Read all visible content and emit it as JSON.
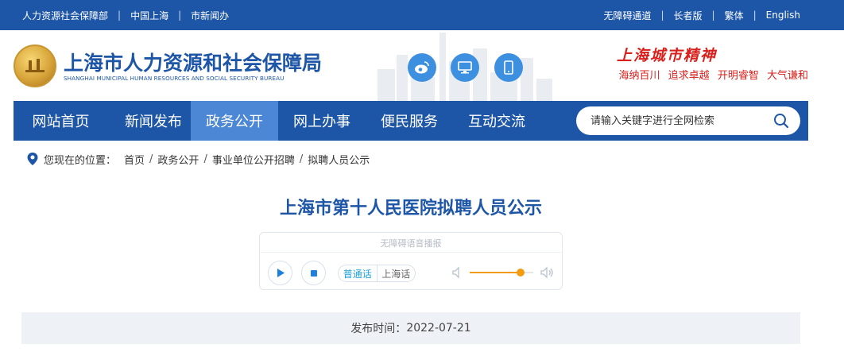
{
  "topbar": {
    "left_links": [
      "人力资源社会保障部",
      "中国上海",
      "市新闻办"
    ],
    "right_links": [
      "无障碍通道",
      "长者版",
      "繁体",
      "English"
    ]
  },
  "header": {
    "title": "上海市人力资源和社会保障局",
    "subtitle": "SHANGHAI MUNICIPAL HUMAN RESOURCES AND SOCIAL SECURITY BUREAU",
    "social_icons": [
      "weibo-icon",
      "monitor-icon",
      "mobile-icon"
    ],
    "spirit_title": "上海城市精神",
    "slogans": [
      "海纳百川",
      "追求卓越",
      "开明睿智",
      "大气谦和"
    ]
  },
  "nav": {
    "items": [
      "网站首页",
      "新闻发布",
      "政务公开",
      "网上办事",
      "便民服务",
      "互动交流"
    ],
    "active": "政务公开",
    "search_placeholder": "请输入关键字进行全网检索"
  },
  "breadcrumb": {
    "lead": "您现在的位置：",
    "items": [
      "首页",
      "政务公开",
      "事业单位公开招聘",
      "拟聘人员公示"
    ]
  },
  "article": {
    "title": "上海市第十人民医院拟聘人员公示",
    "publish_label": "发布时间：",
    "publish_date": "2022-07-21"
  },
  "player": {
    "title": "无障碍语音播报",
    "lang_options": [
      "普通话",
      "上海话"
    ],
    "selected_lang": "普通话",
    "volume": 0.8
  },
  "colors": {
    "brand_blue": "#1e56a7",
    "nav_active": "#4b87d4",
    "spirit_red": "#d8201c",
    "accent_orange": "#f39c12"
  }
}
